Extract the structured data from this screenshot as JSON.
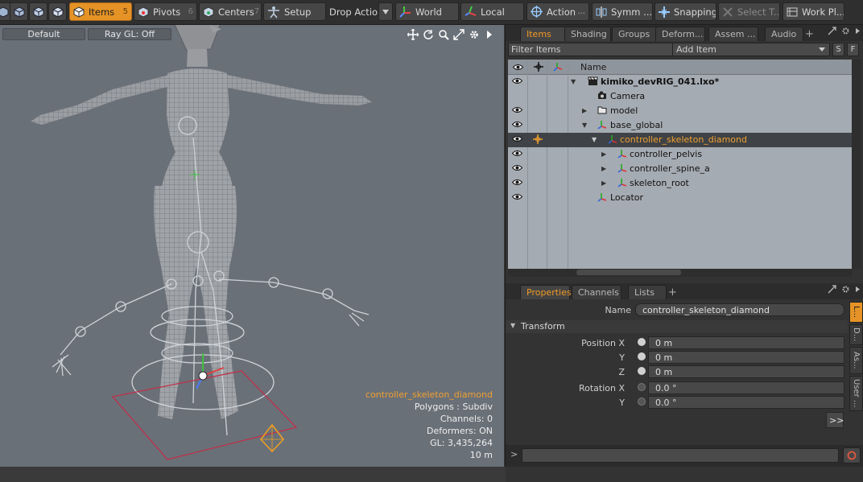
{
  "toolbar": {
    "items": {
      "label": "Items",
      "key": "5"
    },
    "pivots": {
      "label": "Pivots",
      "key": "6"
    },
    "centers": {
      "label": "Centers",
      "key": "7"
    },
    "setup": {
      "label": "Setup"
    },
    "drop_action": {
      "label": "Drop Action"
    },
    "world": {
      "label": "World"
    },
    "local": {
      "label": "Local"
    },
    "action": {
      "label": "Action"
    },
    "symmetry": {
      "label": "Symm ..."
    },
    "snapping": {
      "label": "Snapping"
    },
    "select_through": {
      "label": "Select T..."
    },
    "work_plane": {
      "label": "Work Pl..."
    },
    "active_color": "#e59326"
  },
  "viewport": {
    "shading_mode": "Default",
    "ray_gl": "Ray GL: Off",
    "background": "#6a7078",
    "info": {
      "selected_item": "controller_skeleton_diamond",
      "polygons": "Polygons : Subdiv",
      "channels": "Channels: 0",
      "deformers": "Deformers: ON",
      "gl": "GL: 3,435,264",
      "scale": "10 m"
    }
  },
  "items_panel": {
    "tabs": [
      "Items",
      "Shading",
      "Groups",
      "Deform...",
      "Assem ...",
      "Audio"
    ],
    "active_tab": "Items",
    "filter_placeholder": "Filter Items",
    "add_item_label": "Add Item",
    "s_button": "S",
    "f_button": "F",
    "name_column": "Name",
    "tree": [
      {
        "label": "kimiko_devRIG_041.lxo*",
        "icon": "scene-icon",
        "bold": true,
        "visible": true
      },
      {
        "label": "Camera",
        "icon": "camera-icon",
        "visible": false
      },
      {
        "label": "model",
        "icon": "folder-icon",
        "visible": true
      },
      {
        "label": "base_global",
        "icon": "locator-icon",
        "visible": true
      },
      {
        "label": "controller_skeleton_diamond",
        "icon": "locator-icon",
        "visible": true,
        "selected": true
      },
      {
        "label": "controller_pelvis",
        "icon": "locator-icon",
        "visible": true
      },
      {
        "label": "controller_spine_a",
        "icon": "locator-icon",
        "visible": true
      },
      {
        "label": "skeleton_root",
        "icon": "locator-icon",
        "visible": true
      },
      {
        "label": "Locator",
        "icon": "locator-icon",
        "visible": true
      }
    ]
  },
  "properties_panel": {
    "tabs": [
      "Properties",
      "Channels",
      "Lists"
    ],
    "active_tab": "Properties",
    "name_label": "Name",
    "name_value": "controller_skeleton_diamond",
    "section": "Transform",
    "position_x_label": "Position X",
    "position_y_label": "Y",
    "position_z_label": "Z",
    "position_x": "0 m",
    "position_y": "0 m",
    "position_z": "0 m",
    "rotation_x_label": "Rotation X",
    "rotation_y_label": "Y",
    "rotation_x": "0.0 °",
    "rotation_y": "0.0 °",
    "more_button": ">>",
    "side_tabs": [
      "L...",
      "D...",
      "As...",
      "User ..."
    ]
  },
  "command_bar": {
    "prompt": ">"
  }
}
